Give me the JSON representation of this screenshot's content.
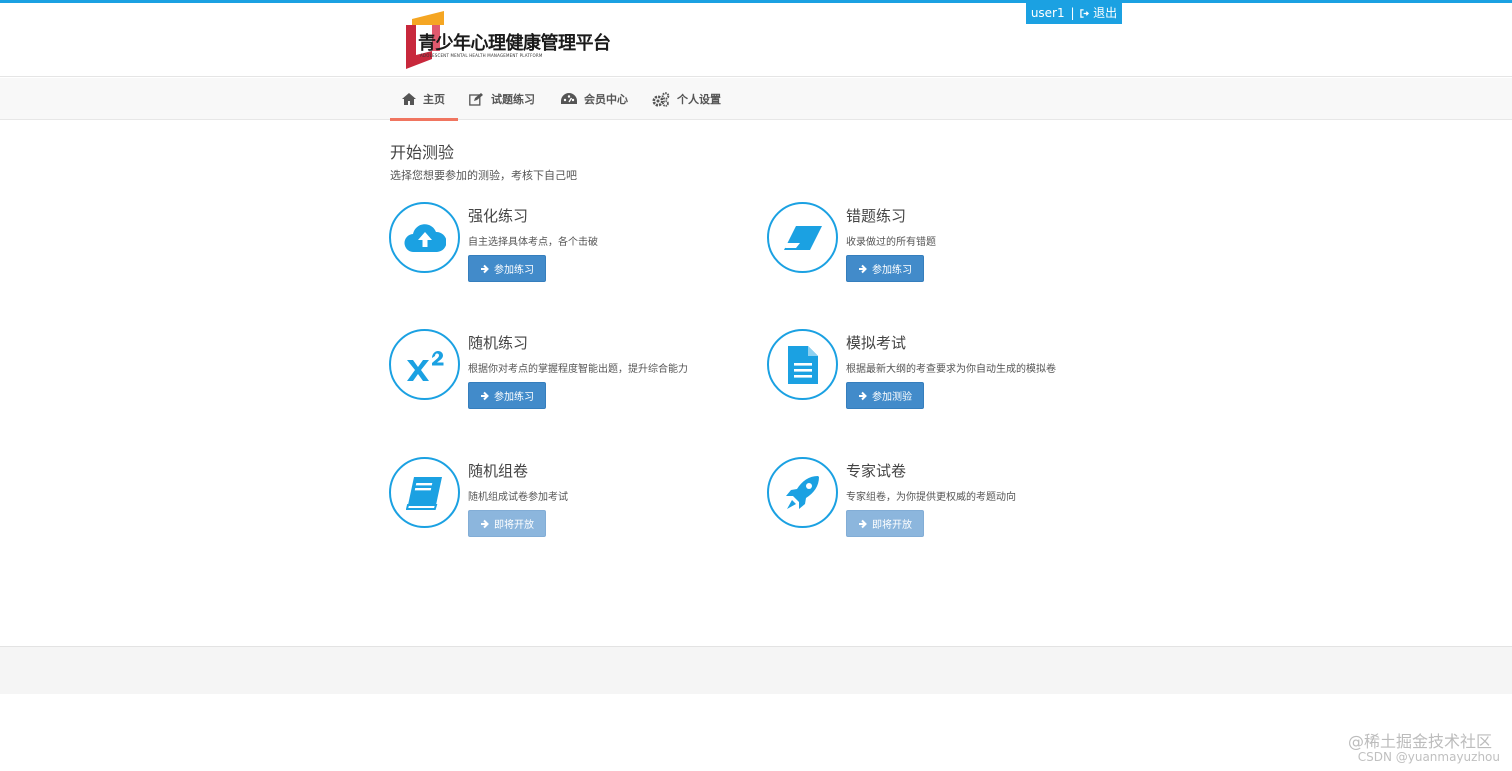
{
  "header": {
    "user": "user1",
    "separator": "|",
    "logout": "退出",
    "logo_title": "青少年心理健康管理平台",
    "logo_subtitle": "ADOLESCENT MENTAL HEALTH MANAGEMENT PLATFORM"
  },
  "nav": [
    {
      "label": "主页",
      "icon": "home-icon",
      "active": true
    },
    {
      "label": "试题练习",
      "icon": "edit-icon",
      "active": false
    },
    {
      "label": "会员中心",
      "icon": "dashboard-icon",
      "active": false
    },
    {
      "label": "个人设置",
      "icon": "gears-icon",
      "active": false
    }
  ],
  "main": {
    "title": "开始测验",
    "subtitle": "选择您想要参加的测验，考核下自己吧",
    "cards": [
      {
        "title": "强化练习",
        "desc": "自主选择具体考点，各个击破",
        "button": "参加练习",
        "icon": "cloud-upload-icon",
        "enabled": true
      },
      {
        "title": "错题练习",
        "desc": "收录做过的所有错题",
        "button": "参加练习",
        "icon": "eraser-icon",
        "enabled": true
      },
      {
        "title": "随机练习",
        "desc": "根据你对考点的掌握程度智能出题，提升综合能力",
        "button": "参加练习",
        "icon": "superscript-icon",
        "enabled": true
      },
      {
        "title": "模拟考试",
        "desc": "根据最新大纲的考查要求为你自动生成的模拟卷",
        "button": "参加测验",
        "icon": "document-icon",
        "enabled": true
      },
      {
        "title": "随机组卷",
        "desc": "随机组成试卷参加考试",
        "button": "即将开放",
        "icon": "book-icon",
        "enabled": false
      },
      {
        "title": "专家试卷",
        "desc": "专家组卷，为你提供更权威的考题动向",
        "button": "即将开放",
        "icon": "rocket-icon",
        "enabled": false
      }
    ]
  },
  "watermark": {
    "line1": "@稀土掘金技术社区",
    "line2": "CSDN @yuanmayuzhou"
  },
  "colors": {
    "accent": "#1ba1e2",
    "button": "#428bca",
    "button_disabled": "#8cb6dd",
    "nav_active": "#f07560"
  }
}
